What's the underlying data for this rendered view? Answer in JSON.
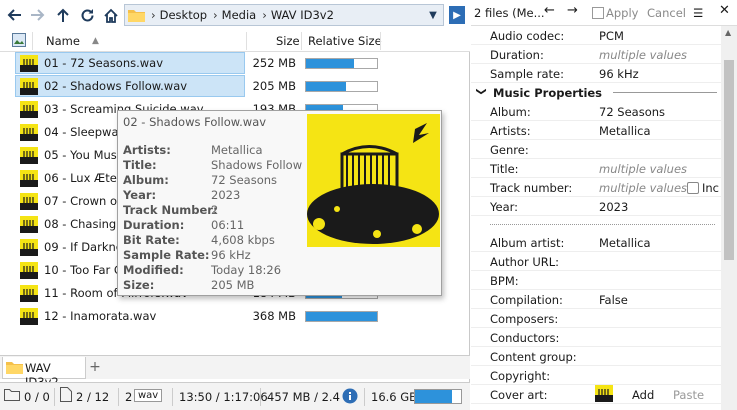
{
  "toolbar": {
    "breadcrumbs": [
      "Desktop",
      "Media",
      "WAV ID3v2"
    ]
  },
  "columns": {
    "name": "Name",
    "size": "Size",
    "relative_size": "Relative Size"
  },
  "files": [
    {
      "name": "01 - 72 Seasons.wav",
      "size": "252 MB",
      "rel": 0.68,
      "selected": true
    },
    {
      "name": "02 - Shadows Follow.wav",
      "size": "205 MB",
      "rel": 0.56,
      "selected": true
    },
    {
      "name": "03 - Screaming Suicide.wav",
      "size": "193 MB",
      "rel": 0.52,
      "selected": false
    },
    {
      "name": "04 - Sleepwalk My Life Away.wav",
      "size": "",
      "rel": 0,
      "selected": false
    },
    {
      "name": "05 - You Must Burn!.wav",
      "size": "",
      "rel": 0,
      "selected": false
    },
    {
      "name": "06 - Lux Æterna.wav",
      "size": "",
      "rel": 0,
      "selected": false
    },
    {
      "name": "07 - Crown of Barbed Wire.wav",
      "size": "",
      "rel": 0,
      "selected": false
    },
    {
      "name": "08 - Chasing Light.wav",
      "size": "",
      "rel": 0,
      "selected": false
    },
    {
      "name": "09 - If Darkness Had a Son.wav",
      "size": "",
      "rel": 0,
      "selected": false
    },
    {
      "name": "10 - Too Far Gone.wav",
      "size": "",
      "rel": 0,
      "selected": false
    },
    {
      "name": "11 - Room of Mirrors.wav",
      "size": "184 MB",
      "rel": 0.5,
      "selected": false
    },
    {
      "name": "12 - Inamorata.wav",
      "size": "368 MB",
      "rel": 1.0,
      "selected": false
    }
  ],
  "tooltip": {
    "title": "02 - Shadows Follow.wav",
    "fields": [
      {
        "label": "Artists:",
        "value": "Metallica"
      },
      {
        "label": "Title:",
        "value": "Shadows Follow"
      },
      {
        "label": "Album:",
        "value": "72 Seasons"
      },
      {
        "label": "Year:",
        "value": "2023"
      },
      {
        "label": "Track Number:",
        "value": "2"
      },
      {
        "label": "Duration:",
        "value": "06:11"
      },
      {
        "label": "Bit Rate:",
        "value": "4,608 kbps"
      },
      {
        "label": "Sample Rate:",
        "value": "96 kHz"
      },
      {
        "label": "Modified:",
        "value": "Today 18:26"
      },
      {
        "label": "Size:",
        "value": "205 MB"
      }
    ]
  },
  "tabs": {
    "active": "WAV ID3v2"
  },
  "status": {
    "folders": "0 / 0",
    "files": "2 / 12",
    "type_count": "2",
    "type_badge": "wav",
    "duration": "13:50 / 1:17:06",
    "size": "457 MB / 2.4",
    "free_space": "16.6 GB"
  },
  "right": {
    "title": "2 files (Me...",
    "apply": "Apply",
    "cancel": "Cancel",
    "props_top": [
      {
        "k": "Audio codec:",
        "v": "PCM",
        "multi": false
      },
      {
        "k": "Duration:",
        "v": "multiple values",
        "multi": true
      },
      {
        "k": "Sample rate:",
        "v": "96 kHz",
        "multi": false
      }
    ],
    "section": "Music Properties",
    "props_music": [
      {
        "k": "Album:",
        "v": "72 Seasons",
        "multi": false
      },
      {
        "k": "Artists:",
        "v": "Metallica",
        "multi": false
      },
      {
        "k": "Genre:",
        "v": "",
        "multi": false
      },
      {
        "k": "Title:",
        "v": "multiple values",
        "multi": true
      },
      {
        "k": "Track number:",
        "v": "multiple values",
        "multi": true
      },
      {
        "k": "Year:",
        "v": "2023",
        "multi": false
      }
    ],
    "track_check_label": "Inc",
    "props_more": [
      {
        "k": "Album artist:",
        "v": "Metallica",
        "multi": false
      },
      {
        "k": "Author URL:",
        "v": "",
        "multi": false
      },
      {
        "k": "BPM:",
        "v": "",
        "multi": false
      },
      {
        "k": "Compilation:",
        "v": "False",
        "multi": false
      },
      {
        "k": "Composers:",
        "v": "",
        "multi": false
      },
      {
        "k": "Conductors:",
        "v": "",
        "multi": false
      },
      {
        "k": "Content group:",
        "v": "",
        "multi": false
      },
      {
        "k": "Copyright:",
        "v": "",
        "multi": false
      },
      {
        "k": "Cover art:",
        "v": "",
        "multi": false
      }
    ],
    "cover_add": "Add",
    "cover_paste": "Paste"
  }
}
